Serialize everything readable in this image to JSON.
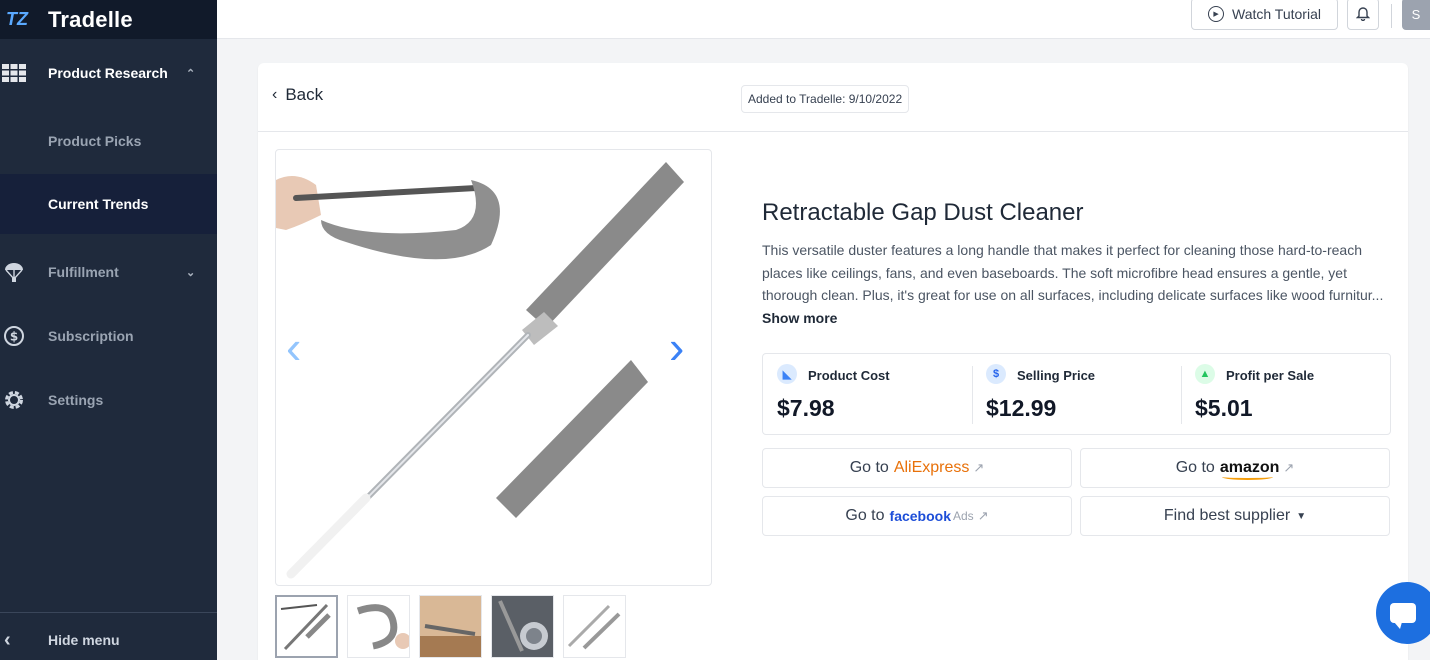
{
  "app": {
    "name": "Tradelle",
    "logo_mark": "TZ"
  },
  "sidebar": {
    "items": [
      {
        "label": "Product Research",
        "icon": "grid-icon",
        "expanded": true
      },
      {
        "label": "Product Picks"
      },
      {
        "label": "Current Trends",
        "active": true
      },
      {
        "label": "Fulfillment",
        "icon": "parachute-icon",
        "expandable": true
      },
      {
        "label": "Subscription",
        "icon": "dollar-circle-icon"
      },
      {
        "label": "Settings",
        "icon": "gear-icon"
      }
    ],
    "hide_menu": "Hide menu"
  },
  "topbar": {
    "watch_tutorial": "Watch Tutorial",
    "avatar_initial": "S"
  },
  "product": {
    "back_label": "Back",
    "added": "Added to Tradelle: 9/10/2022",
    "title": "Retractable Gap Dust Cleaner",
    "description": "This versatile duster features a long handle that makes it perfect for cleaning those hard-to-reach places like ceilings, fans, and even baseboards. The soft microfibre head ensures a gentle, yet thorough clean. Plus, it's great for use on all surfaces, including delicate surfaces like wood furnitur...",
    "show_more": "Show more",
    "metrics": [
      {
        "label": "Product Cost",
        "value": "$7.98",
        "icon": "cart-icon",
        "color": "#3b82f6"
      },
      {
        "label": "Selling Price",
        "value": "$12.99",
        "icon": "dollar-icon",
        "color": "#2563eb"
      },
      {
        "label": "Profit per Sale",
        "value": "$5.01",
        "icon": "money-bag-icon",
        "color": "#22c55e"
      }
    ],
    "actions": {
      "go_to": "Go to",
      "aliexpress": "AliExpress",
      "amazon": "amazon",
      "facebook": "facebook",
      "ads": "Ads",
      "find_supplier": "Find best supplier"
    },
    "thumbnail_count": 5
  }
}
